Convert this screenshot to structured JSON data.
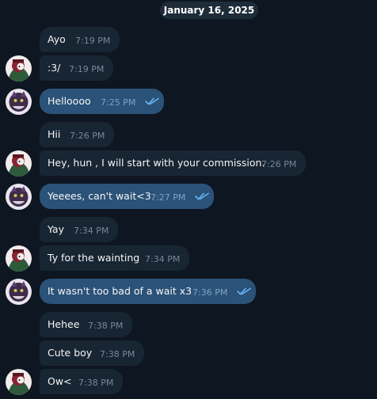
{
  "date_label": "January 16, 2025",
  "colors": {
    "background": "#0e1621",
    "incoming_bubble": "#182533",
    "outgoing_bubble": "#2b5278",
    "read_check": "#6ab3f3"
  },
  "messages": [
    {
      "text": "Ayo",
      "time": "7:19 PM",
      "direction": "in",
      "avatar": null,
      "read": false
    },
    {
      "text": ":3/",
      "time": "7:19 PM",
      "direction": "in",
      "avatar": "contact-avatar",
      "read": false
    },
    {
      "text": "Helloooo",
      "time": "7:25 PM",
      "direction": "out",
      "avatar": "user-avatar",
      "read": true
    },
    {
      "text": "Hii",
      "time": "7:26 PM",
      "direction": "in",
      "avatar": null,
      "read": false
    },
    {
      "text": "Hey, hun , I will start with your commission.",
      "time": "7:26 PM",
      "direction": "in",
      "avatar": "contact-avatar",
      "read": false
    },
    {
      "text": "Yeeees, can't wait<3",
      "time": "7:27 PM",
      "direction": "out",
      "avatar": "user-avatar",
      "read": true
    },
    {
      "text": "Yay",
      "time": "7:34 PM",
      "direction": "in",
      "avatar": null,
      "read": false
    },
    {
      "text": "Ty for the wainting",
      "time": "7:34 PM",
      "direction": "in",
      "avatar": "contact-avatar",
      "read": false
    },
    {
      "text": "It wasn't too bad of a wait x3",
      "time": "7:36 PM",
      "direction": "out",
      "avatar": "user-avatar",
      "read": true
    },
    {
      "text": "Hehee",
      "time": "7:38 PM",
      "direction": "in",
      "avatar": null,
      "read": false
    },
    {
      "text": "Cute boy",
      "time": "7:38 PM",
      "direction": "in",
      "avatar": null,
      "read": false
    },
    {
      "text": "Ow<",
      "time": "7:38 PM",
      "direction": "in",
      "avatar": "contact-avatar",
      "read": false
    }
  ]
}
